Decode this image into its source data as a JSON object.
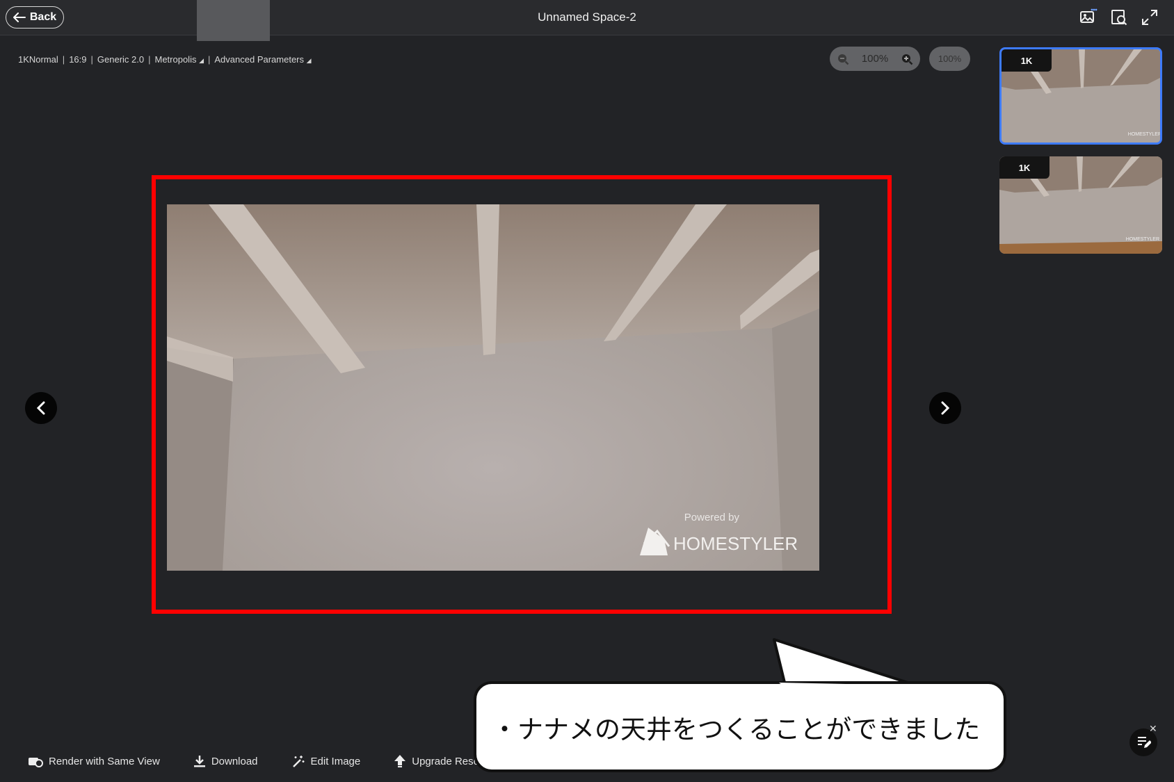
{
  "header": {
    "back_label": "Back",
    "title": "Unnamed Space-2"
  },
  "params": {
    "quality": "1KNormal",
    "ratio": "16:9",
    "engine": "Generic 2.0",
    "style": "Metropolis",
    "advanced": "Advanced Parameters"
  },
  "zoom": {
    "value": "100%",
    "reset_label": "100%"
  },
  "preview": {
    "watermark_powered": "Powered by",
    "watermark_brand": "HOMESTYLER"
  },
  "thumbnails": [
    {
      "label": "1K",
      "selected": true
    },
    {
      "label": "1K",
      "selected": false
    }
  ],
  "toolbar": {
    "render_same_view": "Render with Same View",
    "download": "Download",
    "edit_image": "Edit Image",
    "upgrade": "Upgrade Reso"
  },
  "callout": {
    "text": "・ナナメの天井をつくることができました"
  },
  "colors": {
    "background": "#222326",
    "highlight_frame": "#ff0000",
    "selected_thumb": "#3d7bff"
  }
}
